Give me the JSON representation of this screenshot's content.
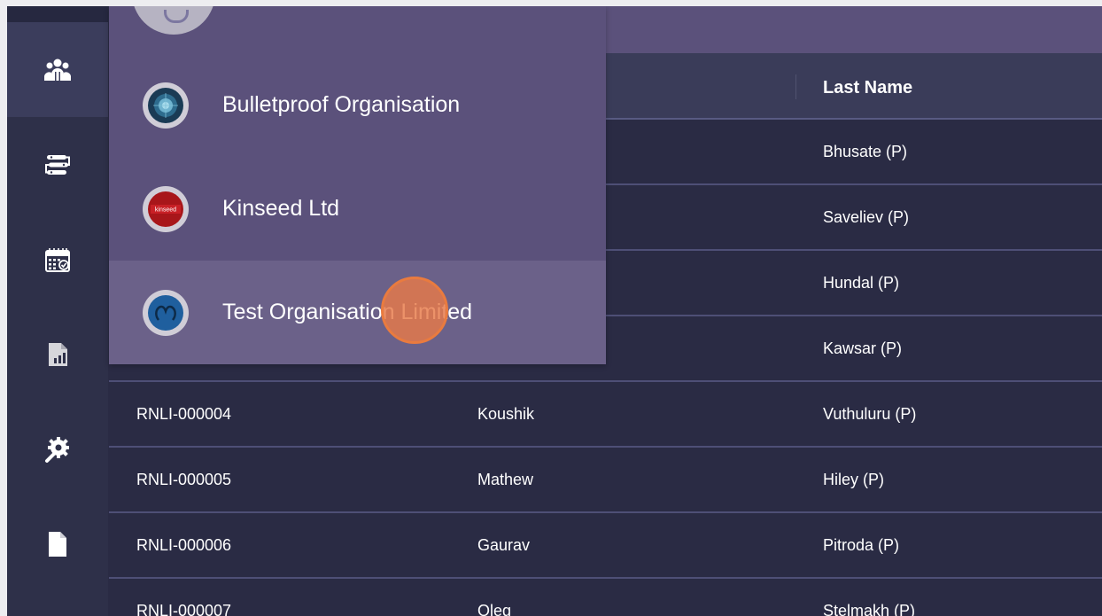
{
  "sidebar": {
    "items": [
      {
        "icon": "users-icon"
      },
      {
        "icon": "workflow-icon"
      },
      {
        "icon": "calendar-icon"
      },
      {
        "icon": "report-icon"
      },
      {
        "icon": "settings-icon"
      },
      {
        "icon": "document-icon"
      }
    ]
  },
  "table": {
    "headers": {
      "last_name": "Last Name"
    },
    "rows": [
      {
        "id": "",
        "first": "",
        "last": "Bhusate (P)"
      },
      {
        "id": "",
        "first": "",
        "last": "Saveliev (P)"
      },
      {
        "id": "",
        "first": "",
        "last": "Hundal (P)"
      },
      {
        "id": "",
        "first": "",
        "last": "Kawsar (P)"
      },
      {
        "id": "RNLI-000004",
        "first": "Koushik",
        "last": "Vuthuluru (P)"
      },
      {
        "id": "RNLI-000005",
        "first": "Mathew",
        "last": "Hiley (P)"
      },
      {
        "id": "RNLI-000006",
        "first": "Gaurav",
        "last": "Pitroda (P)"
      },
      {
        "id": "RNLI-000007",
        "first": "Oleg",
        "last": "Stelmakh (P)"
      }
    ]
  },
  "org_dropdown": {
    "items": [
      {
        "label": "Bulletproof Organisation",
        "icon": "bulletproof-logo"
      },
      {
        "label": "Kinseed Ltd",
        "icon": "kinseed-logo",
        "logo_text": "kinseed"
      },
      {
        "label": "Test Organisation Limited",
        "icon": "test-org-logo",
        "highlighted": true
      }
    ]
  },
  "colors": {
    "sidebar": "#2e3049",
    "dropdown": "#5b517b",
    "dropdown_highlight": "#6b6189",
    "table_bg": "#2a2b44",
    "click_indicator": "#e97b3f"
  }
}
